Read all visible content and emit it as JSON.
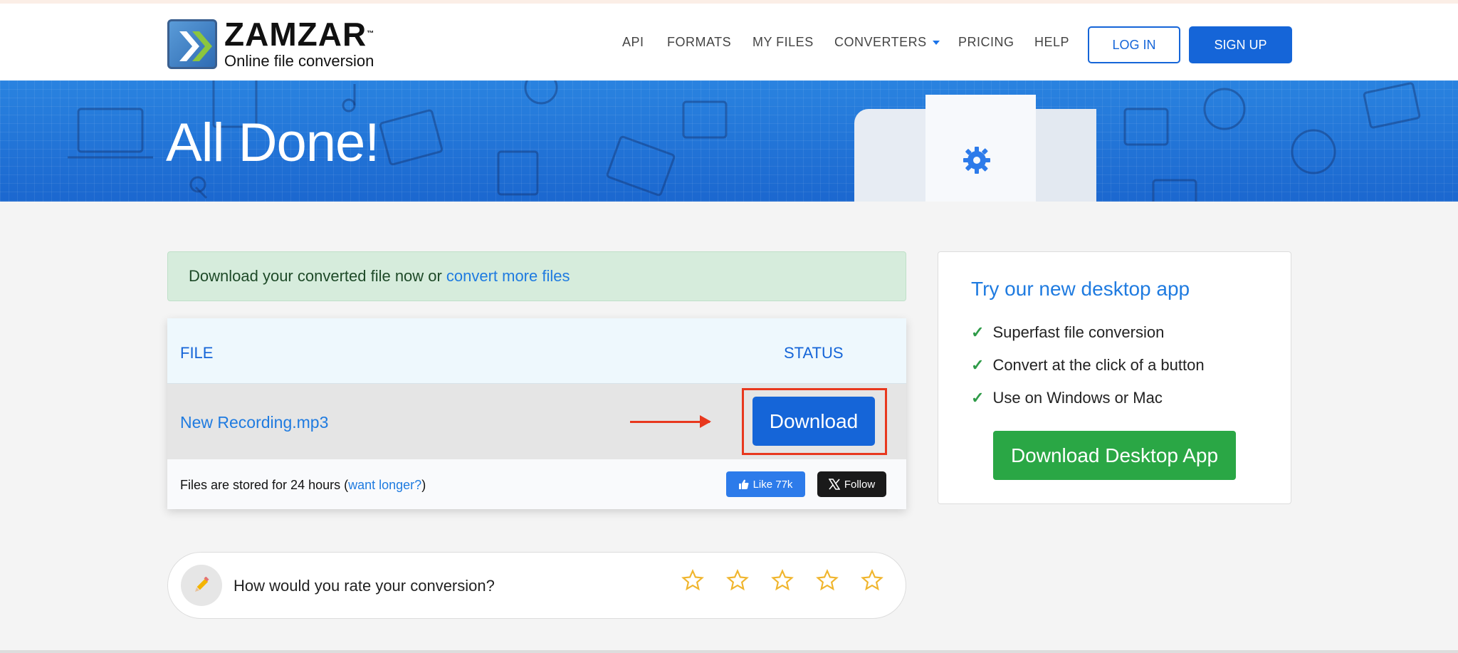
{
  "brand": {
    "name": "ZAMZAR",
    "trademark": "™",
    "tagline": "Online file conversion"
  },
  "nav": {
    "items": [
      "API",
      "FORMATS",
      "MY FILES",
      "CONVERTERS",
      "PRICING",
      "HELP"
    ],
    "login": "LOG IN",
    "signup": "SIGN UP"
  },
  "hero": {
    "title": "All Done!"
  },
  "alert": {
    "text": "Download your converted file now or",
    "link": "convert more files"
  },
  "table": {
    "headers": {
      "file": "FILE",
      "status": "STATUS"
    },
    "row": {
      "filename": "New Recording.mp3",
      "action": "Download"
    },
    "footer": {
      "text_before": "Files are stored for 24 hours (",
      "link": "want longer?",
      "text_after": ")"
    },
    "like": "Like 77k",
    "follow": "Follow"
  },
  "rating": {
    "question": "How would you rate your conversion?",
    "stars": 5
  },
  "sidebar": {
    "title": "Try our new desktop app",
    "features": [
      "Superfast file conversion",
      "Convert at the click of a button",
      "Use on Windows or Mac"
    ],
    "button": "Download Desktop App"
  },
  "colors": {
    "primary": "#1565d8",
    "link": "#1f7be0",
    "success": "#2aa745",
    "highlight": "#e8381e"
  }
}
